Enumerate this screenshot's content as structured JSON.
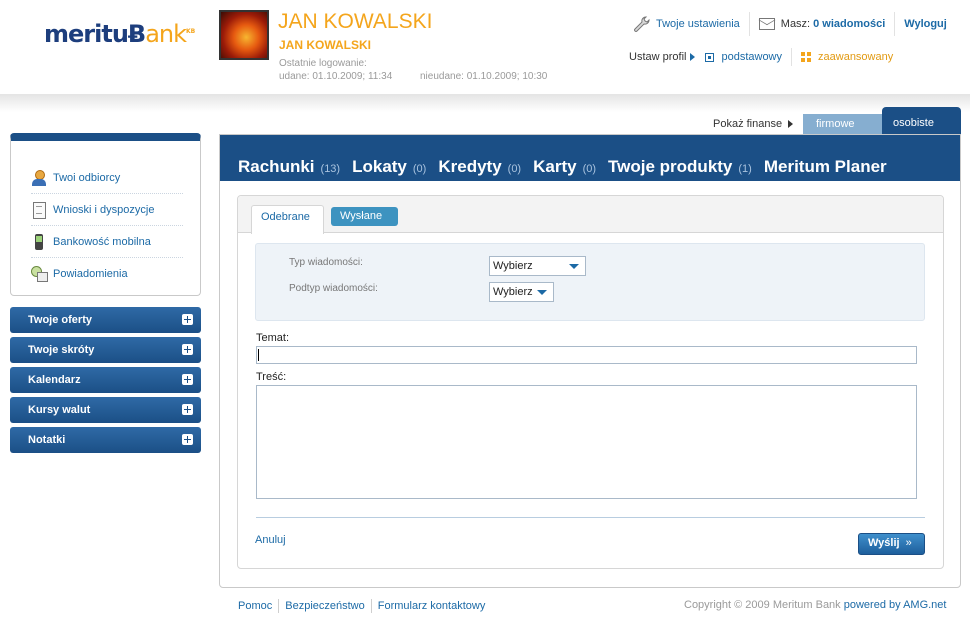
{
  "brand": {
    "name_left": "meritu",
    "name_mid": "Ƀ",
    "name_right": "ank",
    "superscript": "KB"
  },
  "user": {
    "name_big": "JAN KOWALSKI",
    "name_small": "JAN KOWALSKI",
    "last_login_label": "Ostatnie logowanie:",
    "login_success": "udane: 01.10.2009; 11:34",
    "login_failed": "nieudane: 01.10.2009; 10:30"
  },
  "top_links": {
    "settings": "Twoje ustawienia",
    "messages_prefix": "Masz:",
    "messages_link": "0 wiadomości",
    "logout": "Wyloguj"
  },
  "profile": {
    "label": "Ustaw profil",
    "basic": "podstawowy",
    "advanced": "zaawansowany"
  },
  "finance": {
    "label": "Pokaż finanse",
    "tabs": [
      "firmowe",
      "osobiste"
    ],
    "active": "osobiste"
  },
  "sidebar": {
    "items": [
      {
        "label": "Twoi odbiorcy",
        "icon": "person-icon"
      },
      {
        "label": "Wnioski i dyspozycje",
        "icon": "document-icon"
      },
      {
        "label": "Bankowość mobilna",
        "icon": "mobile-phone-icon"
      },
      {
        "label": "Powiadomienia",
        "icon": "notification-icon"
      }
    ],
    "sections": [
      {
        "label": "Twoje oferty"
      },
      {
        "label": "Twoje skróty"
      },
      {
        "label": "Kalendarz"
      },
      {
        "label": "Kursy walut"
      },
      {
        "label": "Notatki"
      }
    ]
  },
  "main_nav": [
    {
      "label": "Rachunki",
      "count": "(13)"
    },
    {
      "label": "Lokaty",
      "count": "(0)"
    },
    {
      "label": "Kredyty",
      "count": "(0)"
    },
    {
      "label": "Karty",
      "count": "(0)"
    },
    {
      "label": "Twoje produkty",
      "count": "(1)"
    },
    {
      "label": "Meritum Planer",
      "count": ""
    }
  ],
  "message_form": {
    "tabs": [
      "Odebrane",
      "Wysłane"
    ],
    "active_tab": "Odebrane",
    "type_label": "Typ wiadomości:",
    "type_value": "Wybierz",
    "subtype_label": "Podtyp wiadomości:",
    "subtype_value": "Wybierz",
    "subject_label": "Temat:",
    "subject_value": "",
    "body_label": "Treść:",
    "body_value": "",
    "cancel": "Anuluj",
    "send": "Wyślij",
    "send_arrow": "»"
  },
  "footer": {
    "links": [
      "Pomoc",
      "Bezpieczeństwo",
      "Formularz kontaktowy"
    ],
    "copyright": "Copyright © 2009 Meritum Bank",
    "powered": "powered by AMG.net"
  },
  "colors": {
    "brand_navy": "#1b4f86",
    "accent_orange": "#f4a51c",
    "link_blue": "#1c6aa6",
    "tab_light": "#86aed0"
  }
}
